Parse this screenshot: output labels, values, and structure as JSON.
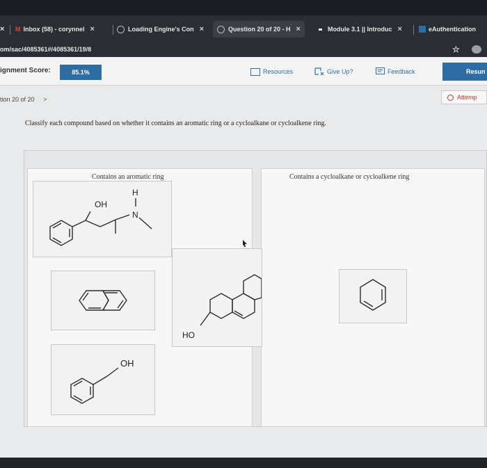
{
  "browser": {
    "tabs": [
      {
        "label": "Inbox (58) - corynnel",
        "closable": true
      },
      {
        "label": "Loading Engine's Con",
        "closable": true
      },
      {
        "label": "Question 20 of 20 - H",
        "closable": true,
        "active": true
      },
      {
        "label": "Module 3.1 || Introduc",
        "closable": true
      },
      {
        "label": "eAuthentication",
        "closable": false
      }
    ],
    "url": "om/sac/4085361#/4085361/19/8"
  },
  "header": {
    "score_label": "ignment Score:",
    "score_value": "85.1%",
    "resources_label": "Resources",
    "giveup_label": "Give Up?",
    "feedback_label": "Feedback",
    "resume_label": "Resun"
  },
  "question_nav": {
    "label": "tion 20 of 20",
    "attempt_label": "Attemp"
  },
  "instruction": "Classify each compound based on whether it contains an aromatic ring or a cycloalkane or cycloalkene ring.",
  "bins": {
    "aromatic_title": "Contains an aromatic ring",
    "cyclo_title": "Contains a cycloalkane or cycloalkene ring"
  },
  "compounds": {
    "amino_alcohol": {
      "oh_label": "OH",
      "h_label": "H",
      "n_label": "N"
    },
    "tricyclic": {
      "ho_label": "HO"
    },
    "benzyl_alcohol": {
      "oh_label": "OH"
    }
  },
  "colors": {
    "accent": "#2e6da4",
    "attempt_red": "#c0392b",
    "card_bg": "#f2f2f2"
  }
}
